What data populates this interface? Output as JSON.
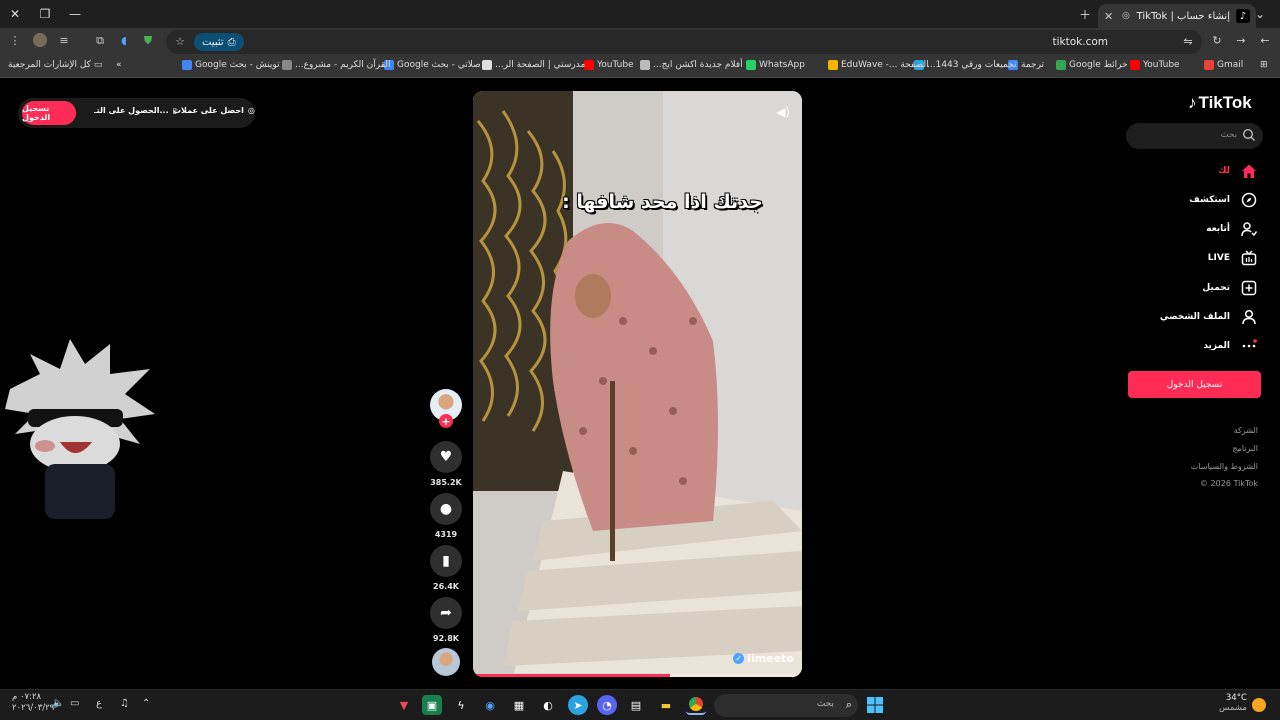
{
  "browser": {
    "tab": {
      "title": "إنشاء حساب | TikTok"
    },
    "url": "tiktok.com",
    "install_label": "تثبيت",
    "bookmarks": [
      "Gmail",
      "YouTube",
      "خرائط Google",
      "ترجمة",
      "تجميعات ورقي 1443...",
      "الصفحة ...- EduWave",
      "WhatsApp",
      "أفلام جديدة اكشن ايج...",
      "YouTube",
      "مدرستي | الصفحة الر...",
      "صلاتي - بحث Google",
      "القرآن الكريم - مشروع...",
      "توينش - بحث Google"
    ],
    "bookmarks_folder": "كل الإشارات المرجعية",
    "bookmark_colors": [
      "#ea4335",
      "#ff0000",
      "#34a853",
      "#4285f4",
      "#2aa3e0",
      "#f4b400",
      "#25d366",
      "#bbbbbb",
      "#ff0000",
      "#dddddd",
      "#4285f4",
      "#888888",
      "#4285f4"
    ]
  },
  "topbar": {
    "login": "تسجيل الدخول",
    "get_app": "الحصول على التـ...",
    "get_coins": "احصل على عملات"
  },
  "video": {
    "caption": "جدتك اذا محد شافها :",
    "watermark": "iimeeto",
    "progress": 0.6
  },
  "actions": {
    "likes": "385.2K",
    "comments": "4319",
    "saves": "26.4K",
    "shares": "92.8K"
  },
  "sidebar": {
    "logo": "TikTok",
    "search_placeholder": "بحث",
    "nav": [
      {
        "label": "لك",
        "icon": "home-icon",
        "active": true
      },
      {
        "label": "استكشف",
        "icon": "compass-icon"
      },
      {
        "label": "أتابعه",
        "icon": "following-icon"
      },
      {
        "label": "LIVE",
        "icon": "live-icon"
      },
      {
        "label": "تحميل",
        "icon": "upload-icon"
      },
      {
        "label": "الملف الشخصي",
        "icon": "profile-icon"
      },
      {
        "label": "المزيد",
        "icon": "more-icon"
      }
    ],
    "login_button": "تسجيل الدخول",
    "footer": [
      "الشركة",
      "البرنامج",
      "الشروط والسياسات",
      "© 2026 TikTok"
    ]
  },
  "taskbar": {
    "search_placeholder": "بحث",
    "weather_temp": "34°C",
    "weather_desc": "مشمس",
    "time": "٠٧:٢٨ م",
    "date": "٢٠٢٦/٠٣/٢٩",
    "lang": "ع"
  },
  "colors": {
    "accent": "#fe2c55"
  }
}
